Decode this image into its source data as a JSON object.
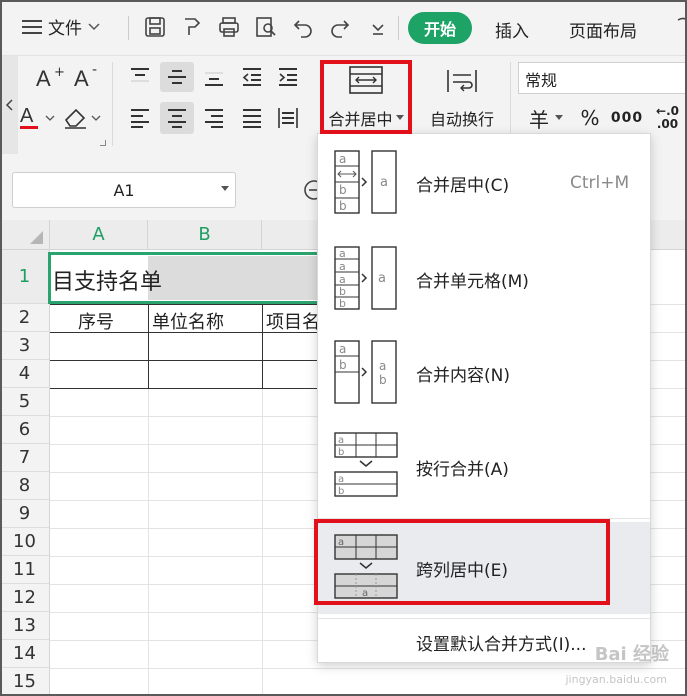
{
  "menubar": {
    "file_label": "文件",
    "tabs": [
      {
        "label": "开始",
        "active": true
      },
      {
        "label": "插入",
        "active": false
      },
      {
        "label": "页面布局",
        "active": false
      }
    ]
  },
  "ribbon": {
    "merge_center_label": "合并居中",
    "wrap_text_label": "自动换行",
    "number_format_value": "常规",
    "currency_symbol": "羊",
    "percent_symbol": "%",
    "thousands_symbol": "000",
    "decimal_increase": "←.0",
    "decimal_value": ".00"
  },
  "namebox": {
    "value": "A1"
  },
  "columns": [
    "A",
    "B"
  ],
  "rows": [
    "1",
    "2",
    "3",
    "4",
    "5",
    "6",
    "7",
    "8",
    "9",
    "10",
    "11",
    "12",
    "13",
    "14",
    "15"
  ],
  "cells": {
    "a1": "目支持名单",
    "a2": "序号",
    "b2": "单位名称",
    "c2": "项目名"
  },
  "merge_menu": {
    "items": [
      {
        "label": "合并居中(C)",
        "shortcut": "Ctrl+M",
        "icon": "merge-center-icon"
      },
      {
        "label": "合并单元格(M)",
        "shortcut": "",
        "icon": "merge-cells-icon"
      },
      {
        "label": "合并内容(N)",
        "shortcut": "",
        "icon": "merge-content-icon"
      },
      {
        "label": "按行合并(A)",
        "shortcut": "",
        "icon": "merge-by-row-icon"
      },
      {
        "label": "跨列居中(E)",
        "shortcut": "",
        "icon": "center-across-columns-icon",
        "highlighted": true
      }
    ],
    "default_setting_label": "设置默认合并方式(I)..."
  },
  "watermark": {
    "text": "Bai 经验",
    "sub": "jingyan.baidu.com"
  },
  "colors": {
    "accent": "#1ea366",
    "highlight_box": "#e2101b"
  }
}
